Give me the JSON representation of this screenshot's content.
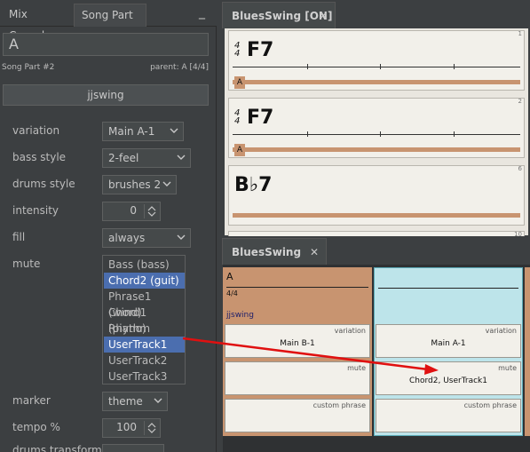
{
  "left_panel": {
    "tabs": {
      "mix_console": "Mix Console",
      "song_part": "Song Part",
      "minimize": "_"
    },
    "name_value": "A",
    "song_part_no": "Song Part #2",
    "parent": "parent: A [4/4]",
    "rhythm_button": "jjswing",
    "params": {
      "variation": {
        "label": "variation",
        "value": "Main A-1"
      },
      "bass_style": {
        "label": "bass style",
        "value": "2-feel"
      },
      "drums_style": {
        "label": "drums style",
        "value": "brushes 2"
      },
      "intensity": {
        "label": "intensity",
        "value": "0"
      },
      "fill": {
        "label": "fill",
        "value": "always"
      },
      "mute": {
        "label": "mute",
        "items": [
          "Bass (bass)",
          "Chord2 (guit)",
          "Phrase1 (wind)",
          "Chord1 (piano)",
          "Rhythm",
          "UserTrack1",
          "UserTrack2",
          "UserTrack3"
        ],
        "selected": [
          "Chord2 (guit)",
          "UserTrack1"
        ]
      },
      "marker": {
        "label": "marker",
        "value": "theme"
      },
      "tempo": {
        "label": "tempo %",
        "value": "100"
      },
      "drums_transform": {
        "label": "drums transform"
      }
    }
  },
  "top_editor": {
    "tab_title": "BluesSwing [ON]",
    "close": "✕",
    "bars": [
      {
        "number": "1",
        "time_sig_top": "4",
        "time_sig_bottom": "4",
        "chord": "F7",
        "marker": "A"
      },
      {
        "number": "2",
        "time_sig_top": "4",
        "time_sig_bottom": "4",
        "chord": "F7",
        "marker": "A"
      },
      {
        "number": "6",
        "chord": "B♭7"
      },
      {
        "number": "10"
      }
    ]
  },
  "bottom_editor": {
    "tab_title": "BluesSwing [ON]",
    "close": "✕",
    "part_a": {
      "name": "A",
      "time_sig": "4/4",
      "rhythm": "jjswing"
    },
    "cells": {
      "variation_label": "variation",
      "mute_label": "mute",
      "custom_phrase_label": "custom phrase",
      "part_a_variation": "Main B-1",
      "part_b_variation": "Main A-1",
      "part_b_mute": "Chord2, UserTrack1"
    }
  },
  "colors": {
    "background": "#3c3f41",
    "selection": "#4b6eaf",
    "part_tan": "#c89470",
    "part_cyan": "#bde4ea",
    "arrow": "#e01010"
  }
}
